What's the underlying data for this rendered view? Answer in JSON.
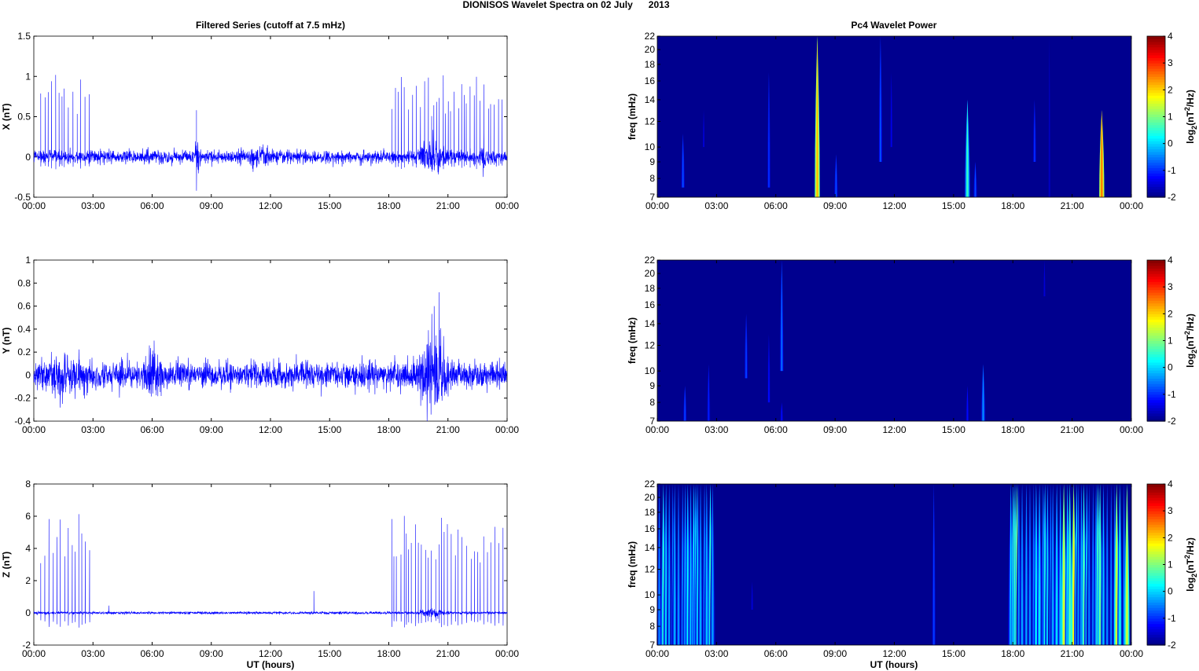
{
  "figure_title": "DIONISOS Wavelet Spectra on 02 July      2013",
  "left_column_title": "Filtered Series (cutoff at 7.5 mHz)",
  "right_column_title": "Pc4 Wavelet Power",
  "xlabel": "UT (hours)",
  "time_tick_labels": [
    "00:00",
    "03:00",
    "06:00",
    "09:00",
    "12:00",
    "15:00",
    "18:00",
    "21:00",
    "00:00"
  ],
  "colorbar": {
    "label_prefix": "log",
    "label_sub": "2",
    "label_mid": "(nT",
    "label_sup": "2",
    "label_end": "/Hz)",
    "range": [
      -2,
      4
    ],
    "ticks": [
      "-2",
      "-1",
      "0",
      "1",
      "2",
      "3",
      "4"
    ],
    "colormap": "jet"
  },
  "line_color": "#0000ff",
  "background_color": "#00008f",
  "chart_data": [
    {
      "type": "line",
      "name": "X",
      "ylabel": "X (nT)",
      "xlim": [
        0,
        24
      ],
      "ylim": [
        -0.5,
        1.5
      ],
      "yticks": [
        "-0.5",
        "0",
        "0.5",
        "1",
        "1.5"
      ],
      "yvals": [
        -0.5,
        0,
        0.5,
        1,
        1.5
      ],
      "noise": 0.05,
      "spike_windows": [
        [
          0.35,
          2.9
        ],
        [
          18.15,
          23.95
        ]
      ],
      "spike_spacing": 0.17,
      "spike_amp": [
        0.5,
        1.02
      ],
      "bursts": [
        {
          "t": 8.3,
          "w": 0.1,
          "amp": 0.15
        },
        {
          "t": 11.5,
          "w": 0.6,
          "amp": 0.04
        },
        {
          "t": 20.2,
          "w": 0.5,
          "amp": 0.12
        },
        {
          "t": 22.8,
          "w": 0.1,
          "amp": 0.15
        }
      ],
      "singles": [
        {
          "t": 8.25,
          "v": 0.58
        },
        {
          "t": 8.25,
          "v": -0.42
        }
      ]
    },
    {
      "type": "line",
      "name": "Y",
      "ylabel": "Y (nT)",
      "xlim": [
        0,
        24
      ],
      "ylim": [
        -0.4,
        1
      ],
      "yticks": [
        "-0.4",
        "-0.2",
        "0",
        "0.2",
        "0.4",
        "0.6",
        "0.8",
        "1"
      ],
      "yvals": [
        -0.4,
        -0.2,
        0,
        0.2,
        0.4,
        0.6,
        0.8,
        1
      ],
      "noise": 0.07,
      "spike_windows": [],
      "spike_spacing": 1,
      "spike_amp": [
        0,
        0
      ],
      "bursts": [
        {
          "t": 1.5,
          "w": 1.2,
          "amp": 0.04
        },
        {
          "t": 6.0,
          "w": 0.4,
          "amp": 0.07
        },
        {
          "t": 20.2,
          "w": 0.6,
          "amp": 0.2
        }
      ],
      "singles": [
        {
          "t": 20.55,
          "v": 0.72
        },
        {
          "t": 20.3,
          "v": 0.6
        },
        {
          "t": 6.1,
          "v": 0.3
        }
      ]
    },
    {
      "type": "line",
      "name": "Z",
      "ylabel": "Z (nT)",
      "xlim": [
        0,
        24
      ],
      "ylim": [
        -2,
        8
      ],
      "yticks": [
        "-2",
        "0",
        "2",
        "4",
        "6",
        "8"
      ],
      "yvals": [
        -2,
        0,
        2,
        4,
        6,
        8
      ],
      "noise": 0.05,
      "spike_windows": [
        [
          0.35,
          2.9
        ],
        [
          18.15,
          23.95
        ]
      ],
      "spike_spacing": 0.17,
      "spike_amp": [
        3.0,
        6.2
      ],
      "bursts": [
        {
          "t": 20.2,
          "w": 0.5,
          "amp": 0.15
        }
      ],
      "singles": [
        {
          "t": 14.2,
          "v": 1.35
        },
        {
          "t": 3.8,
          "v": 0.45
        }
      ]
    },
    {
      "type": "heatmap",
      "name": "X wavelet",
      "ylabel": "freq (mHz)",
      "xlim": [
        0,
        24
      ],
      "ylim": [
        7,
        22
      ],
      "yscale": "log",
      "yticks": [
        "7",
        "8",
        "9",
        "10",
        "12",
        "14",
        "16",
        "18",
        "20",
        "22"
      ],
      "yvals": [
        7,
        8,
        9,
        10,
        12,
        14,
        16,
        18,
        20,
        22
      ],
      "events": [
        {
          "t": 1.3,
          "f": [
            7.5,
            11
          ],
          "p": -0.8
        },
        {
          "t": 2.35,
          "f": [
            10,
            13
          ],
          "p": -1.5
        },
        {
          "t": 5.65,
          "f": [
            7.5,
            17
          ],
          "p": -1.0
        },
        {
          "t": 8.1,
          "f": [
            7,
            22
          ],
          "p": 2.2
        },
        {
          "t": 9.05,
          "f": [
            7,
            9.5
          ],
          "p": -0.8
        },
        {
          "t": 11.3,
          "f": [
            9,
            22
          ],
          "p": -0.8
        },
        {
          "t": 11.85,
          "f": [
            10,
            17
          ],
          "p": -1.4
        },
        {
          "t": 15.7,
          "f": [
            7,
            14
          ],
          "p": 0.6
        },
        {
          "t": 16.1,
          "f": [
            7,
            9
          ],
          "p": -0.8
        },
        {
          "t": 19.1,
          "f": [
            9,
            14
          ],
          "p": -1.0
        },
        {
          "t": 19.85,
          "f": [
            7,
            22
          ],
          "p": -1.6
        },
        {
          "t": 22.5,
          "f": [
            7,
            13
          ],
          "p": 2.6
        }
      ]
    },
    {
      "type": "heatmap",
      "name": "Y wavelet",
      "ylabel": "freq (mHz)",
      "xlim": [
        0,
        24
      ],
      "ylim": [
        7,
        22
      ],
      "yscale": "log",
      "yticks": [
        "7",
        "8",
        "9",
        "10",
        "12",
        "14",
        "16",
        "18",
        "20",
        "22"
      ],
      "yvals": [
        7,
        8,
        9,
        10,
        12,
        14,
        16,
        18,
        20,
        22
      ],
      "events": [
        {
          "t": 1.4,
          "f": [
            7,
            9
          ],
          "p": -0.9
        },
        {
          "t": 2.6,
          "f": [
            7,
            10.5
          ],
          "p": -1.1
        },
        {
          "t": 4.5,
          "f": [
            9.5,
            15
          ],
          "p": -0.9
        },
        {
          "t": 5.65,
          "f": [
            8,
            13
          ],
          "p": -1.2
        },
        {
          "t": 6.3,
          "f": [
            10,
            22
          ],
          "p": -0.6
        },
        {
          "t": 15.7,
          "f": [
            7,
            9
          ],
          "p": -1.2
        },
        {
          "t": 16.5,
          "f": [
            7,
            10.5
          ],
          "p": -0.4
        },
        {
          "t": 19.6,
          "f": [
            17,
            22
          ],
          "p": -1.5
        },
        {
          "t": 6.3,
          "f": [
            7,
            8
          ],
          "p": -1.2
        }
      ]
    },
    {
      "type": "heatmap",
      "name": "Z wavelet",
      "ylabel": "freq (mHz)",
      "xlim": [
        0,
        24
      ],
      "ylim": [
        7,
        22
      ],
      "yscale": "log",
      "yticks": [
        "7",
        "8",
        "9",
        "10",
        "12",
        "14",
        "16",
        "18",
        "20",
        "22"
      ],
      "yvals": [
        7,
        8,
        9,
        10,
        12,
        14,
        16,
        18,
        20,
        22
      ],
      "streak_windows": [
        [
          0.1,
          2.9
        ],
        [
          17.9,
          23.8
        ]
      ],
      "streak_spacing": 0.17,
      "streak_power": [
        -0.5,
        2.6
      ],
      "events": [
        {
          "t": 14.0,
          "f": [
            7,
            22
          ],
          "p": -0.9
        },
        {
          "t": 4.8,
          "f": [
            9,
            11
          ],
          "p": -1.5
        }
      ]
    }
  ]
}
